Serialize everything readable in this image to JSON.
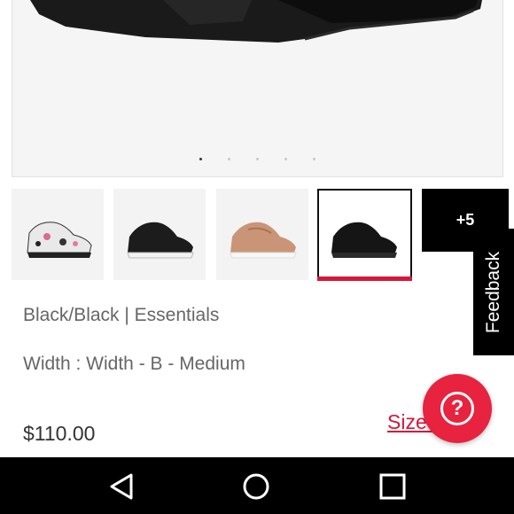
{
  "product": {
    "color_label": "Black/Black | Essentials",
    "width_label": "Width : Width - B - Medium",
    "price": "$110.00",
    "size_chart_label": "Size Chart"
  },
  "gallery": {
    "dots_count": 5,
    "active_dot": 0,
    "thumbnails": [
      {
        "name": "floral-sneaker",
        "selected": false
      },
      {
        "name": "black-white-sole-sneaker",
        "selected": false
      },
      {
        "name": "rose-gold-sneaker",
        "selected": false
      },
      {
        "name": "all-black-sneaker",
        "selected": true
      }
    ],
    "more_label": "+5"
  },
  "feedback": {
    "label": "Feedback"
  },
  "help": {
    "icon": "question-icon",
    "glyph": "?"
  },
  "navbar": {
    "icons": [
      "back-triangle-icon",
      "home-circle-icon",
      "recents-square-icon"
    ]
  },
  "colors": {
    "accent": "#d6173a",
    "fab": "#e8233f",
    "dark": "#000000"
  }
}
